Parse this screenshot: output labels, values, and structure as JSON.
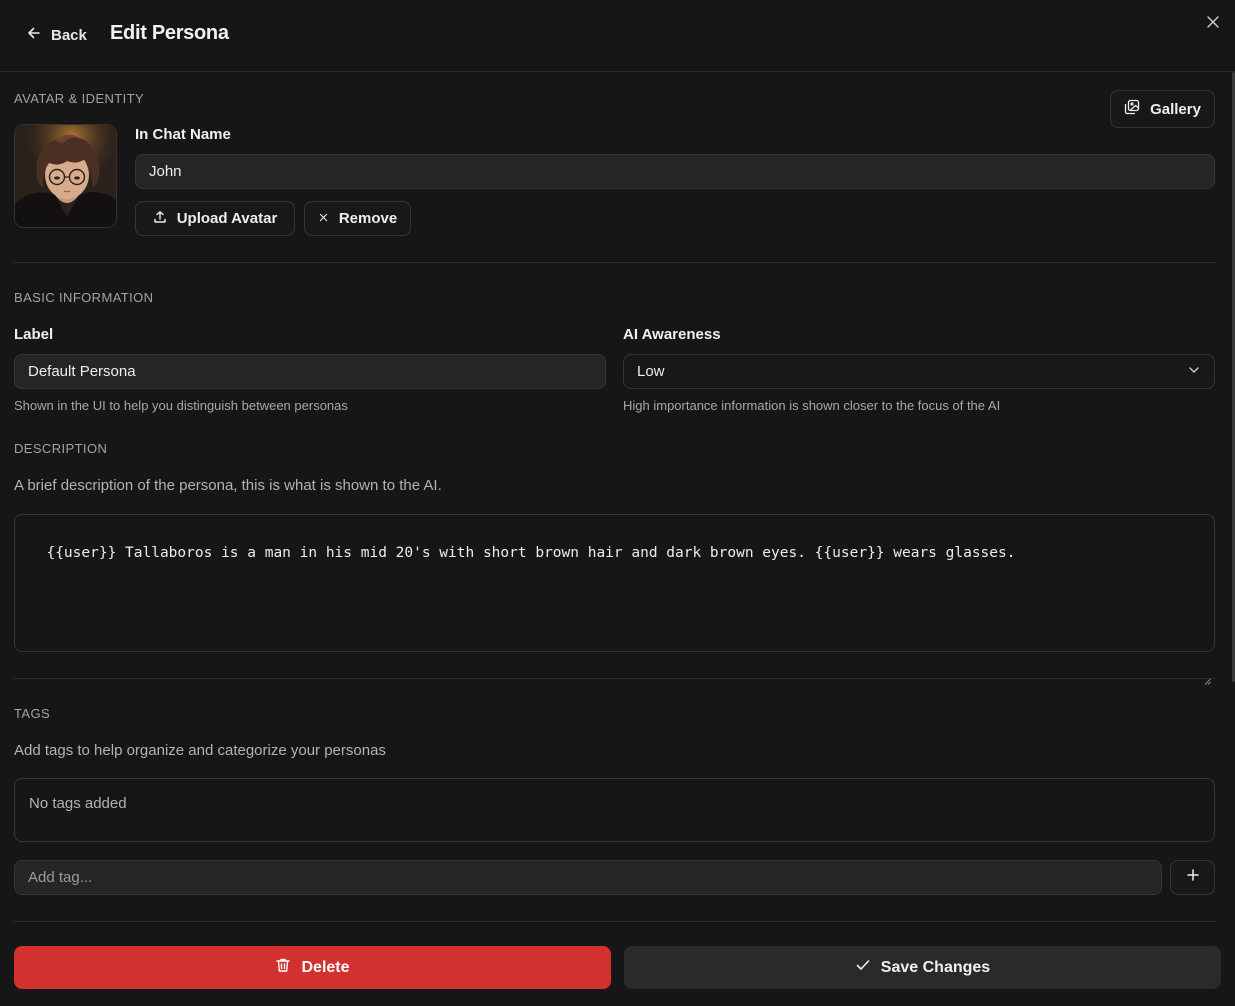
{
  "header": {
    "back_label": "Back",
    "title": "Edit Persona"
  },
  "avatar_section": {
    "heading": "AVATAR & IDENTITY",
    "gallery_label": "Gallery",
    "name_label": "In Chat Name",
    "name_value": "John",
    "upload_label": "Upload Avatar",
    "remove_label": "Remove"
  },
  "basic_info": {
    "heading": "BASIC INFORMATION",
    "label_label": "Label",
    "label_value": "Default Persona",
    "label_hint": "Shown in the UI to help you distinguish between personas",
    "awareness_label": "AI Awareness",
    "awareness_value": "Low",
    "awareness_hint": "High importance information is shown closer to the focus of the AI"
  },
  "description": {
    "heading": "DESCRIPTION",
    "subtitle": "A brief description of the persona, this is what is shown to the AI.",
    "value": "{{user}} Tallaboros is a man in his mid 20's with short brown hair and dark brown eyes. {{user}} wears glasses."
  },
  "tags": {
    "heading": "TAGS",
    "subtitle": "Add tags to help organize and categorize your personas",
    "empty_text": "No tags added",
    "input_placeholder": "Add tag..."
  },
  "footer": {
    "delete_label": "Delete",
    "save_label": "Save Changes"
  },
  "colors": {
    "background": "#161616",
    "delete_red": "#d33030",
    "input_bg": "#252525"
  }
}
